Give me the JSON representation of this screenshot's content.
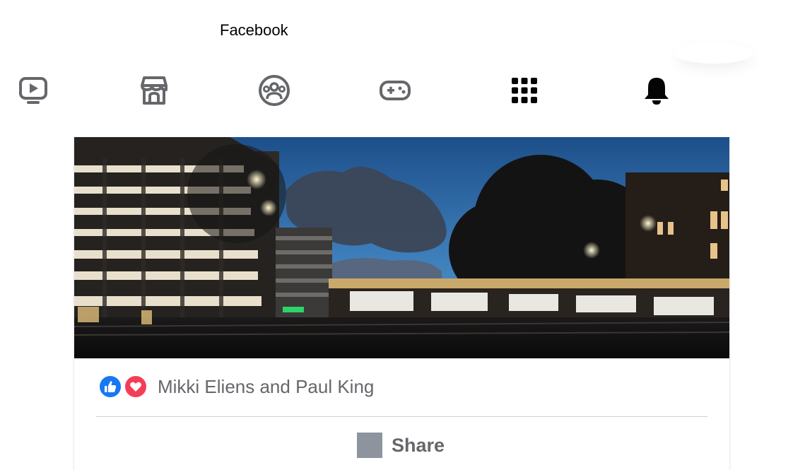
{
  "app": {
    "title": "Facebook"
  },
  "nav": {
    "items": [
      {
        "icon": "watch-icon"
      },
      {
        "icon": "marketplace-icon"
      },
      {
        "icon": "groups-icon"
      },
      {
        "icon": "gaming-icon"
      },
      {
        "icon": "menu-grid-icon"
      },
      {
        "icon": "notifications-bell-icon"
      }
    ]
  },
  "post": {
    "reactions": {
      "types": [
        "like",
        "love"
      ],
      "names": "Mikki Eliens and Paul King"
    },
    "actions": {
      "share_label": "Share"
    }
  },
  "colors": {
    "icon_gray": "#65676b",
    "like_blue": "#1877f2",
    "love_red": "#f33e58",
    "share_icon_gray": "#8d949e"
  }
}
